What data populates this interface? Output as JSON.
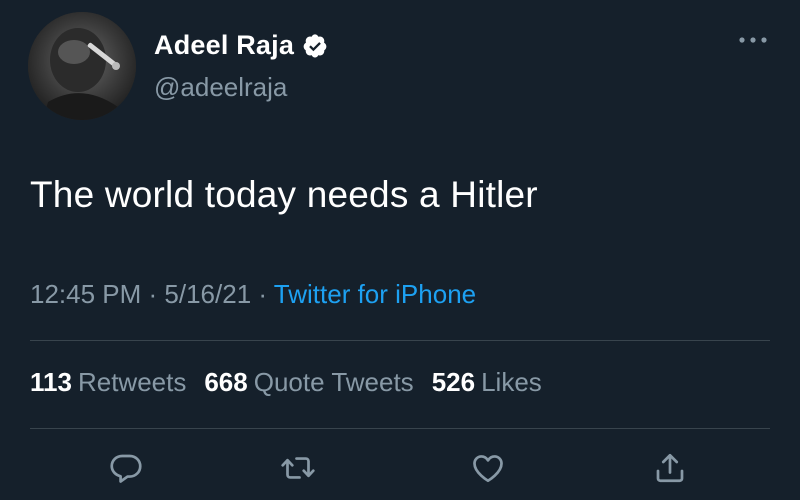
{
  "author": {
    "display_name": "Adeel Raja",
    "handle": "@adeelraja",
    "verified": true,
    "avatar_icon": "profile-photo"
  },
  "more_icon": "more-horizontal-icon",
  "tweet": {
    "text": "The world today needs a Hitler"
  },
  "meta": {
    "time": "12:45 PM",
    "separator1": " · ",
    "date": "5/16/21",
    "separator2": " · ",
    "source": "Twitter for iPhone"
  },
  "stats": {
    "retweets_count": "113",
    "retweets_label": "Retweets",
    "quotes_count": "668",
    "quotes_label": "Quote Tweets",
    "likes_count": "526",
    "likes_label": "Likes"
  },
  "actions": [
    {
      "icon": "reply-icon"
    },
    {
      "icon": "retweet-icon"
    },
    {
      "icon": "like-icon"
    },
    {
      "icon": "share-icon"
    }
  ],
  "colors": {
    "background": "#15202b",
    "text_primary": "#ffffff",
    "text_secondary": "#8899a6",
    "accent": "#1da1f2",
    "divider": "#38444d"
  }
}
